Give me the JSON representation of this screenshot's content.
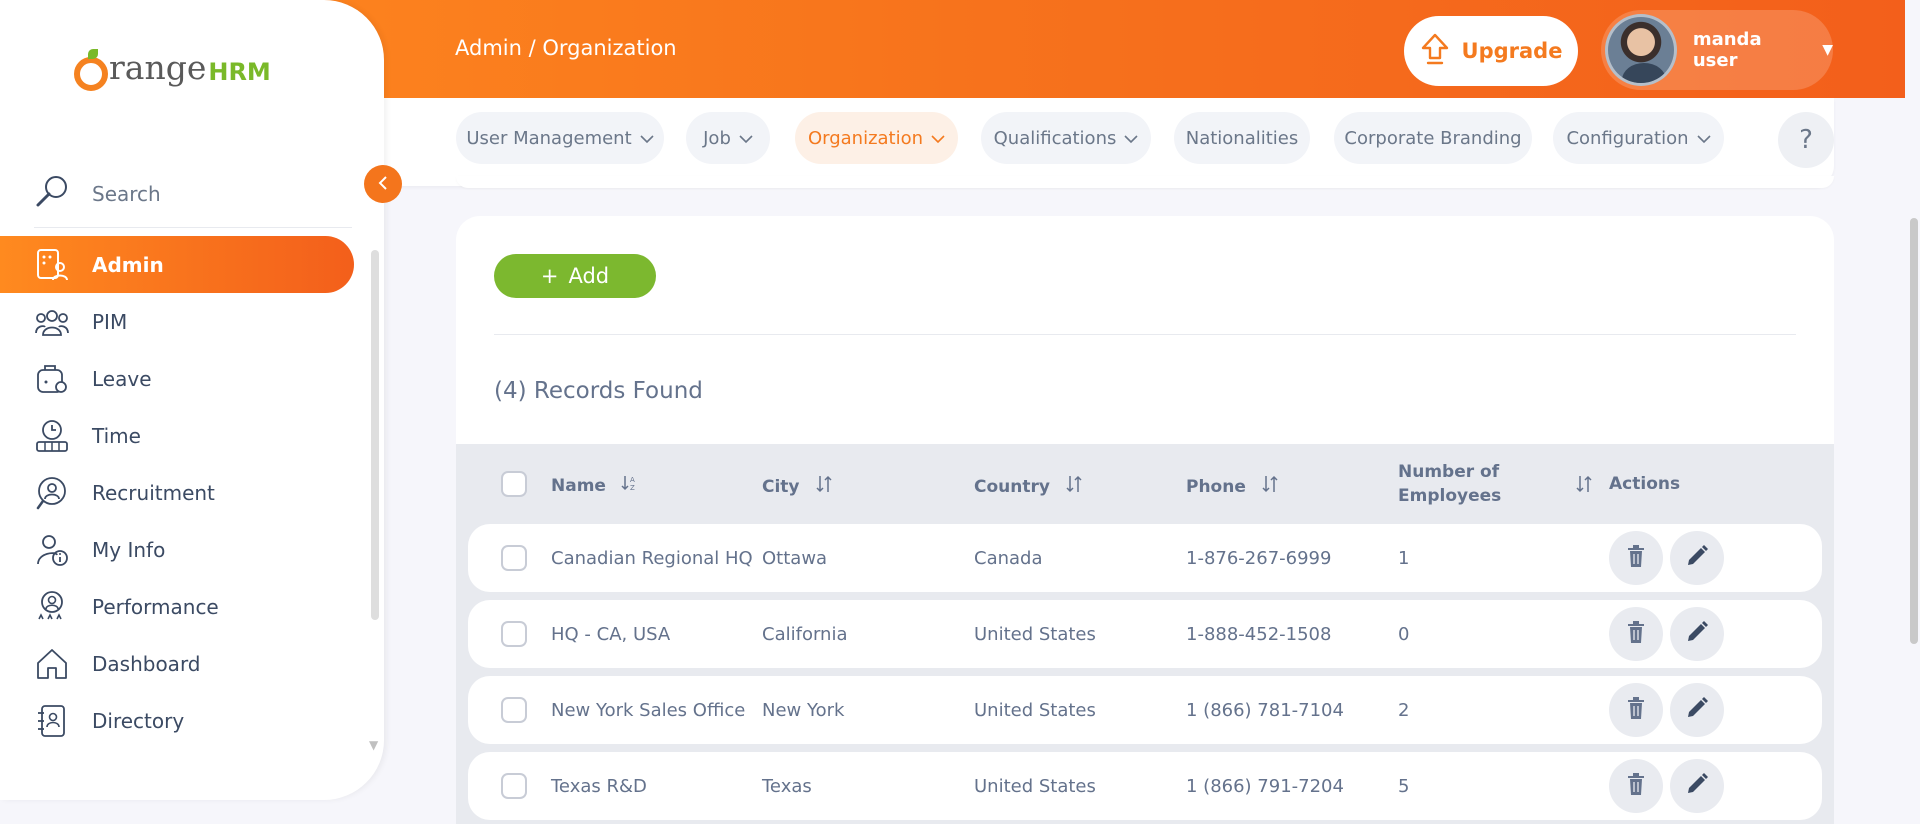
{
  "header": {
    "breadcrumb": "Admin / Organization",
    "upgrade_label": "Upgrade",
    "user_name": "manda user"
  },
  "topnav": {
    "items": [
      {
        "label": "User Management",
        "dropdown": true
      },
      {
        "label": "Job",
        "dropdown": true
      },
      {
        "label": "Organization",
        "dropdown": true,
        "active": true
      },
      {
        "label": "Qualifications",
        "dropdown": true
      },
      {
        "label": "Nationalities",
        "dropdown": false
      },
      {
        "label": "Corporate Branding",
        "dropdown": false
      },
      {
        "label": "Configuration",
        "dropdown": true
      }
    ],
    "help_label": "?"
  },
  "sidebar": {
    "logo_text": "range",
    "logo_hrm": "HRM",
    "search_label": "Search",
    "items": [
      {
        "label": "Admin",
        "icon": "admin-icon",
        "active": true
      },
      {
        "label": "PIM",
        "icon": "pim-icon"
      },
      {
        "label": "Leave",
        "icon": "leave-icon"
      },
      {
        "label": "Time",
        "icon": "time-icon"
      },
      {
        "label": "Recruitment",
        "icon": "recruitment-icon"
      },
      {
        "label": "My Info",
        "icon": "my-info-icon"
      },
      {
        "label": "Performance",
        "icon": "performance-icon"
      },
      {
        "label": "Dashboard",
        "icon": "dashboard-icon"
      },
      {
        "label": "Directory",
        "icon": "directory-icon"
      }
    ]
  },
  "main": {
    "add_label": "Add",
    "records_found": "(4) Records Found",
    "table": {
      "headers": {
        "name": "Name",
        "city": "City",
        "country": "Country",
        "phone": "Phone",
        "employees_line1": "Number of",
        "employees_line2": "Employees",
        "actions": "Actions"
      },
      "rows": [
        {
          "name": "Canadian Regional HQ",
          "city": "Ottawa",
          "country": "Canada",
          "phone": "1-876-267-6999",
          "employees": "1"
        },
        {
          "name": "HQ - CA, USA",
          "city": "California",
          "country": "United States",
          "phone": "1-888-452-1508",
          "employees": "0"
        },
        {
          "name": "New York Sales Office",
          "city": "New York",
          "country": "United States",
          "phone": "1 (866) 781-7104",
          "employees": "2"
        },
        {
          "name": "Texas R&D",
          "city": "Texas",
          "country": "United States",
          "phone": "1 (866) 791-7204",
          "employees": "5"
        }
      ]
    }
  },
  "colors": {
    "brand_orange": "#f47a1f",
    "add_green": "#7cb82f",
    "text_slate": "#64728c"
  }
}
